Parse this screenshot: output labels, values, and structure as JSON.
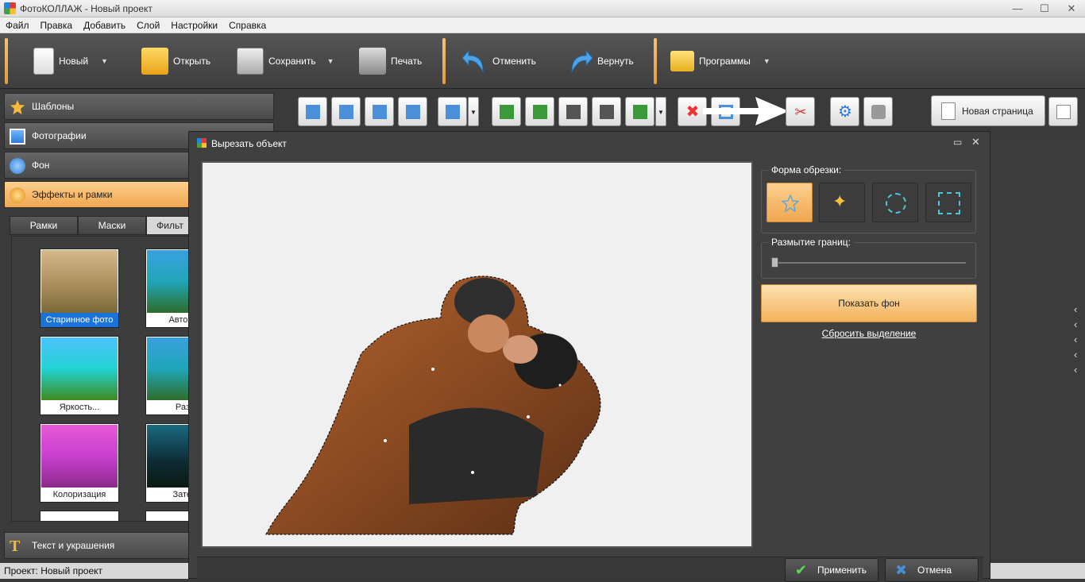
{
  "titlebar": {
    "title": "ФотоКОЛЛАЖ - Новый проект",
    "min": "—",
    "max": "☐",
    "close": "✕"
  },
  "menu": [
    "Файл",
    "Правка",
    "Добавить",
    "Слой",
    "Настройки",
    "Справка"
  ],
  "toolbar": {
    "new": "Новый",
    "open": "Открыть",
    "save": "Сохранить",
    "print": "Печать",
    "undo": "Отменить",
    "redo": "Вернуть",
    "programs": "Программы",
    "dropdown": "▼"
  },
  "left_panel": {
    "sections": [
      "Шаблоны",
      "Фотографии",
      "Фон",
      "Эффекты и рамки"
    ],
    "bottom_section": "Текст и украшения",
    "tabs": [
      "Рамки",
      "Маски",
      "Фильт"
    ],
    "thumbnails": [
      "Старинное фото",
      "Автокон",
      "Яркость...",
      "Разд",
      "Колоризация",
      "Затем"
    ]
  },
  "edit_toolbar": {
    "new_page": "Новая страница"
  },
  "right_panel": {
    "chevron": "‹"
  },
  "dialog": {
    "title": "Вырезать объект",
    "shape_label": "Форма обрезки:",
    "blur_label": "Размытие границ:",
    "show_bg": "Показать фон",
    "reset": "Сбросить выделение",
    "apply": "Применить",
    "cancel": "Отмена",
    "max": "▭",
    "close": "✕"
  },
  "status": {
    "label": "Проект:",
    "value": "Новый проект"
  },
  "colors": {
    "accent": "#f0a650",
    "selection": "#1a73d9"
  }
}
